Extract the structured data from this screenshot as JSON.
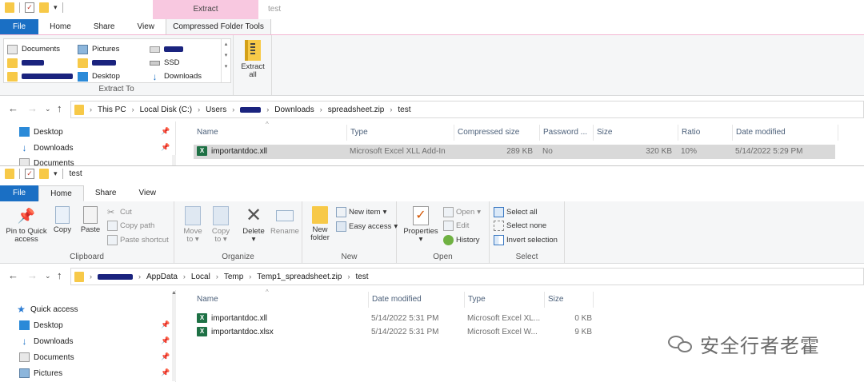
{
  "window1": {
    "title": "test",
    "context_tab_header": "Extract",
    "tabs": [
      "File",
      "Home",
      "Share",
      "View",
      "Compressed Folder Tools"
    ],
    "extract_to": {
      "group_label": "Extract To",
      "items": [
        "Documents",
        "Pictures",
        "SSD",
        "Desktop",
        "Downloads"
      ]
    },
    "extract_all_line1": "Extract",
    "extract_all_line2": "all",
    "address": [
      "This PC",
      "Local Disk (C:)",
      "Users",
      "Downloads",
      "spreadsheet.zip",
      "test"
    ],
    "nav": [
      "Desktop",
      "Downloads",
      "Documents"
    ],
    "columns": [
      "Name",
      "Type",
      "Compressed size",
      "Password ...",
      "Size",
      "Ratio",
      "Date modified"
    ],
    "row": {
      "name": "importantdoc.xll",
      "type": "Microsoft Excel XLL Add-In",
      "compressed": "289 KB",
      "password": "No",
      "size": "320 KB",
      "ratio": "10%",
      "date": "5/14/2022 5:29 PM"
    }
  },
  "window2": {
    "title": "test",
    "tabs": [
      "File",
      "Home",
      "Share",
      "View"
    ],
    "clipboard": {
      "pin_line1": "Pin to Quick",
      "pin_line2": "access",
      "copy": "Copy",
      "paste": "Paste",
      "cut": "Cut",
      "copy_path": "Copy path",
      "paste_shortcut": "Paste shortcut",
      "label": "Clipboard"
    },
    "organize": {
      "move_line1": "Move",
      "move_line2": "to",
      "copy_line1": "Copy",
      "copy_line2": "to",
      "delete": "Delete",
      "rename": "Rename",
      "label": "Organize"
    },
    "new": {
      "folder_line1": "New",
      "folder_line2": "folder",
      "new_item": "New item",
      "easy_access": "Easy access",
      "label": "New"
    },
    "open": {
      "properties": "Properties",
      "open": "Open",
      "edit": "Edit",
      "history": "History",
      "label": "Open"
    },
    "select": {
      "select_all": "Select all",
      "select_none": "Select none",
      "invert": "Invert selection",
      "label": "Select"
    },
    "address": [
      "AppData",
      "Local",
      "Temp",
      "Temp1_spreadsheet.zip",
      "test"
    ],
    "nav": [
      "Quick access",
      "Desktop",
      "Downloads",
      "Documents",
      "Pictures"
    ],
    "columns": [
      "Name",
      "Date modified",
      "Type",
      "Size"
    ],
    "rows": [
      {
        "name": "importantdoc.xll",
        "date": "5/14/2022 5:31 PM",
        "type": "Microsoft Excel XL...",
        "size": "0 KB"
      },
      {
        "name": "importantdoc.xlsx",
        "date": "5/14/2022 5:31 PM",
        "type": "Microsoft Excel W...",
        "size": "9 KB"
      }
    ]
  },
  "watermark": "安全行者老霍"
}
